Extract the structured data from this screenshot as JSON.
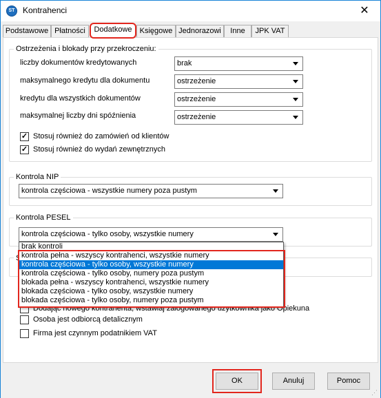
{
  "window": {
    "title": "Kontrahenci",
    "icon": "app-logo-icon",
    "close_glyph": "✕"
  },
  "tabs": [
    {
      "label": "Podstawowe",
      "active": false
    },
    {
      "label": "Płatności",
      "active": false
    },
    {
      "label": "Dodatkowe",
      "active": true
    },
    {
      "label": "Księgowe",
      "active": false
    },
    {
      "label": "Jednorazowi",
      "active": false
    },
    {
      "label": "Inne",
      "active": false
    },
    {
      "label": "JPK VAT",
      "active": false
    }
  ],
  "warnings": {
    "legend": "Ostrzeżenia i blokady przy przekroczeniu:",
    "rows": [
      {
        "label": "liczby dokumentów kredytowanych",
        "value": "brak"
      },
      {
        "label": "maksymalnego kredytu dla  dokumentu",
        "value": "ostrzeżenie"
      },
      {
        "label": "kredytu dla wszystkich dokumentów",
        "value": "ostrzeżenie"
      },
      {
        "label": "maksymalnej liczby dni spóźnienia",
        "value": "ostrzeżenie"
      }
    ],
    "checks": [
      {
        "label": "Stosuj również do zamówień od klientów",
        "checked": true
      },
      {
        "label": "Stosuj również do wydań zewnętrznych",
        "checked": true
      }
    ]
  },
  "nip": {
    "legend": "Kontrola NIP",
    "value": "kontrola częściowa - wszystkie numery poza pustym"
  },
  "pesel": {
    "legend": "Kontrola PESEL",
    "value": "kontrola częściowa - tylko osoby, wszystkie numery",
    "options": [
      "brak kontroli",
      "kontrola pełna - wszyscy kontrahenci, wszystkie numery",
      "kontrola częściowa - tylko osoby, wszystkie numery",
      "kontrola częściowa - tylko osoby, numery poza pustym",
      "blokada pełna - wszyscy kontrahenci, wszystkie numery",
      "blokada częściowa - tylko osoby, wszystkie numery",
      "blokada częściowa - tylko osoby, numery poza pustym"
    ],
    "selected_index": 2
  },
  "hidden_group": {
    "legend_fragment": "S"
  },
  "other_checks": [
    {
      "label": "Dodając nowego kontrahenta, wstawiaj zalogowanego użytkownika jako Opiekuna",
      "checked": false
    },
    {
      "label": "Osoba jest odbiorcą detalicznym",
      "checked": false
    },
    {
      "label": "Firma jest czynnym podatnikiem VAT",
      "checked": false
    }
  ],
  "buttons": {
    "ok": "OK",
    "cancel": "Anuluj",
    "help": "Pomoc"
  },
  "colors": {
    "accent_highlight": "#e2261d",
    "selection": "#0078d7",
    "window_border": "#1883d7"
  }
}
